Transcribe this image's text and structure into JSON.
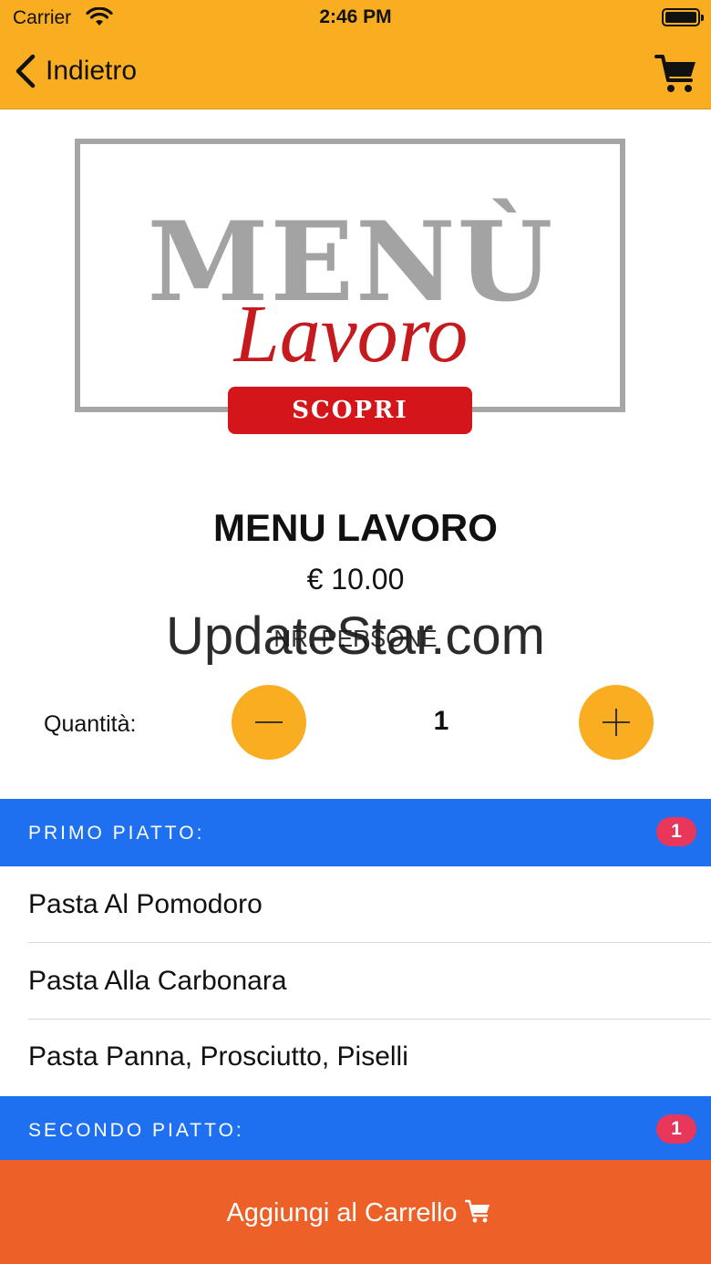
{
  "status_bar": {
    "carrier": "Carrier",
    "time": "2:46 PM",
    "wifi_icon": "wifi-icon",
    "battery_icon": "battery-icon"
  },
  "nav": {
    "back_label": "Indietro",
    "back_icon": "chevron-left-icon",
    "cart_icon": "shopping-cart-icon"
  },
  "banner": {
    "menu_text": "MENÙ",
    "lavoro_text": "Lavoro",
    "button_text": "SCOPRI",
    "frame_color": "#a6a6a6",
    "accent_color": "#d4161b"
  },
  "product": {
    "title": "MENU LAVORO",
    "price": "€ 10.00",
    "persons_label": "NR. PERSONE"
  },
  "watermark": "UpdateStar.com",
  "quantity": {
    "label": "Quantità:",
    "value": "1",
    "minus_icon": "minus-icon",
    "plus_icon": "plus-icon"
  },
  "sections": [
    {
      "title": "PRIMO PIATTO:",
      "badge": "1",
      "items": [
        "Pasta Al Pomodoro",
        "Pasta Alla Carbonara",
        "Pasta Panna, Prosciutto, Piselli"
      ]
    },
    {
      "title": "SECONDO PIATTO:",
      "badge": "1",
      "items": []
    }
  ],
  "footer": {
    "add_to_cart_label": "Aggiungi al Carrello",
    "cart_icon": "shopping-cart-icon"
  },
  "colors": {
    "header": "#f9ae22",
    "section_header": "#1f6ff1",
    "badge": "#e8375a",
    "footer": "#ed6128"
  }
}
